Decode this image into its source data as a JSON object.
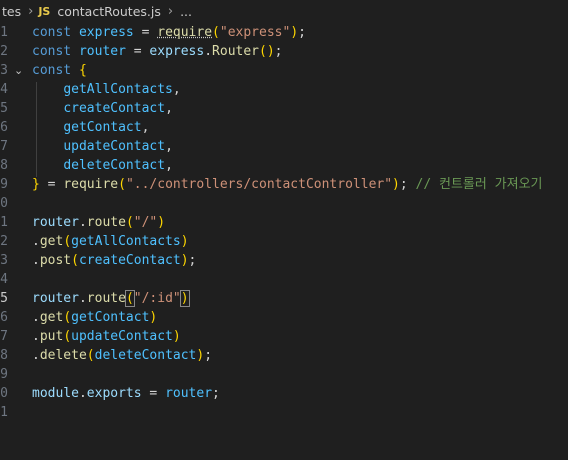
{
  "breadcrumb": {
    "folder": "tes",
    "file_icon": "JS",
    "file": "contactRoutes.js",
    "more": "..."
  },
  "line_numbers": [
    "1",
    "2",
    "3",
    "4",
    "5",
    "6",
    "7",
    "8",
    "9",
    "0",
    "1",
    "2",
    "3",
    "4",
    "5",
    "6",
    "7",
    "8",
    "9",
    "0",
    "1"
  ],
  "code": {
    "l1": {
      "kw": "const",
      "var": "express",
      "eq": " = ",
      "fn": "require",
      "p": "(",
      "str": "\"express\"",
      "pc": ")",
      "end": ";"
    },
    "l2": {
      "kw": "const",
      "var": "router",
      "eq": " = ",
      "obj": "express",
      "dot": ".",
      "fn": "Router",
      "p": "()",
      "end": ";"
    },
    "l3": {
      "kw": "const",
      "brace": "{"
    },
    "l4": "getAllContacts",
    "l5": "createContact",
    "l6": "getContact",
    "l7": "updateContact",
    "l8": "deleteContact",
    "l9": {
      "brace": "}",
      "eq": " = ",
      "fn": "require",
      "p": "(",
      "str": "\"../controllers/contactController\"",
      "pc": ")",
      "end": ";",
      "comment": "// 컨트롤러 가져오기"
    },
    "l11": {
      "obj": "router",
      "dot": ".",
      "fn": "route",
      "p": "(",
      "str": "\"/\"",
      "pc": ")"
    },
    "l12": {
      "dot": ".",
      "fn": "get",
      "p": "(",
      "arg": "getAllContacts",
      "pc": ")"
    },
    "l13": {
      "dot": ".",
      "fn": "post",
      "p": "(",
      "arg": "createContact",
      "pc": ")",
      "end": ";"
    },
    "l15": {
      "obj": "router",
      "dot": ".",
      "fn": "route",
      "p": "(",
      "str": "\"/:id\"",
      "pc": ")"
    },
    "l16": {
      "dot": ".",
      "fn": "get",
      "p": "(",
      "arg": "getContact",
      "pc": ")"
    },
    "l17": {
      "dot": ".",
      "fn": "put",
      "p": "(",
      "arg": "updateContact",
      "pc": ")"
    },
    "l18": {
      "dot": ".",
      "fn": "delete",
      "p": "(",
      "arg": "deleteContact",
      "pc": ")",
      "end": ";"
    },
    "l20": {
      "obj": "module",
      "dot": ".",
      "prop": "exports",
      "eq": " = ",
      "var": "router",
      "end": ";"
    }
  }
}
